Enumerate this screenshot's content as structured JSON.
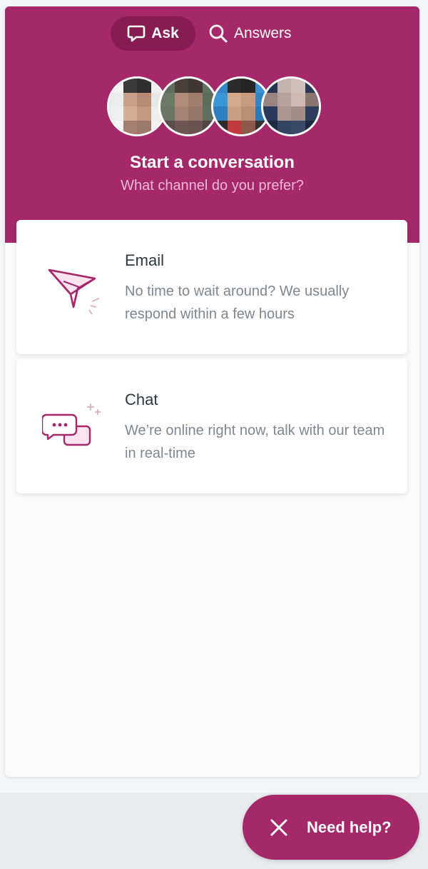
{
  "nav": {
    "ask_label": "Ask",
    "answers_label": "Answers"
  },
  "header": {
    "title": "Start a conversation",
    "subtitle": "What channel do you prefer?"
  },
  "channels": [
    {
      "title": "Email",
      "description": "No time to wait around? We usually respond within a few hours",
      "icon": "paper-plane-icon"
    },
    {
      "title": "Chat",
      "description": "We’re online right now, talk with our team in real-time",
      "icon": "chat-bubbles-icon"
    }
  ],
  "launcher": {
    "label": "Need help?",
    "icon": "close-icon"
  },
  "colors": {
    "brand": "#a4286a",
    "brand_dark": "#861c53",
    "subtitle": "#efb8d6"
  }
}
